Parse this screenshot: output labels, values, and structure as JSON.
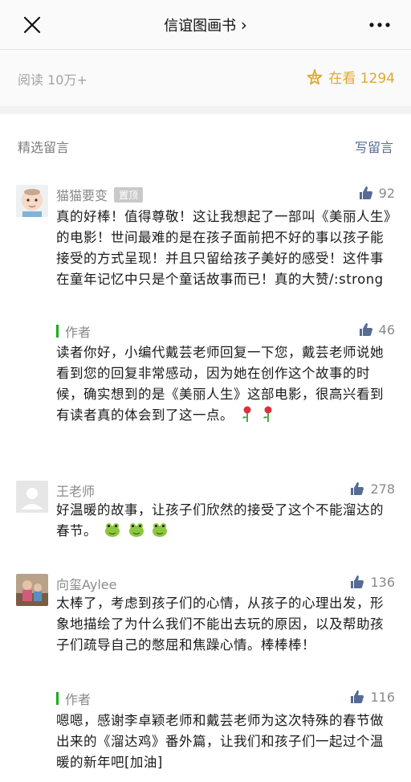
{
  "header": {
    "title": "信谊图画书",
    "title_chevron": "›"
  },
  "stats": {
    "read_label": "阅读 10万+",
    "looking_label": "在看 1294"
  },
  "section": {
    "title": "精选留言",
    "write_label": "写留言"
  },
  "comments": [
    {
      "nickname": "猫猫要变",
      "pinned_label": "置顶",
      "likes": "92",
      "text": "真的好棒！值得尊敬！这让我想起了一部叫《美丽人生》的电影！世间最难的是在孩子面前把不好的事以孩子能接受的方式呈现！并且只留给孩子美好的感受！这件事在童年记忆中只是个童话故事而已！真的大赞/:strong",
      "reply": {
        "author": "作者",
        "likes": "46",
        "text": "读者你好，小编代戴芸老师回复一下您，戴芸老师说她看到您的回复非常感动，因为她在创作这个故事的时候，确实想到的是《美丽人生》这部电影，很高兴看到有读者真的体会到了这一点。"
      }
    },
    {
      "nickname": "王老师",
      "likes": "278",
      "text": "好温暖的故事，让孩子们欣然的接受了这个不能溜达的春节。"
    },
    {
      "nickname": "向玺Aylee",
      "likes": "136",
      "text": "太棒了，考虑到孩子们的心情，从孩子的心理出发，形象地描绘了为什么我们不能出去玩的原因，以及帮助孩子们疏导自己的憋屈和焦躁心情。棒棒棒！",
      "reply": {
        "author": "作者",
        "likes": "116",
        "text": "嗯嗯，感谢李卓颖老师和戴芸老师为这次特殊的春节做出来的《溜达鸡》番外篇，让我们和孩子们一起过个温暖的新年吧[加油]"
      }
    }
  ],
  "colors": {
    "link": "#576b95",
    "looking": "#e0a830",
    "author_bar": "#1aad19",
    "muted": "#8a8a8a"
  },
  "icons": [
    "close-icon",
    "more-icon",
    "sparkle-icon",
    "thumb-up-icon",
    "rose-emoji",
    "frog-emoji"
  ]
}
